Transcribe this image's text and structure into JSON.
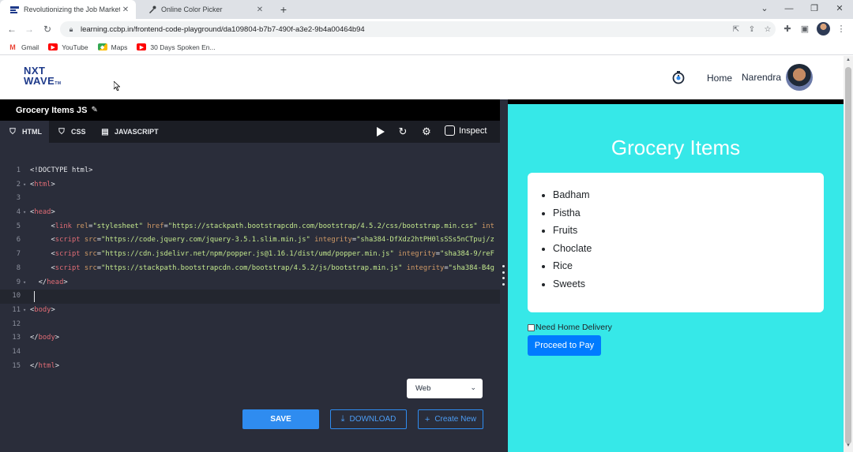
{
  "browser": {
    "tabs": [
      {
        "title": "Revolutionizing the Job Market |",
        "active": true
      },
      {
        "title": "Online Color Picker",
        "active": false
      }
    ],
    "url": "learning.ccbp.in/frontend-code-playground/da109804-b7b7-490f-a3e2-9b4a00464b94",
    "bookmarks": [
      {
        "label": "Gmail",
        "icon": "gmail-icon",
        "color": "#ea4335"
      },
      {
        "label": "YouTube",
        "icon": "youtube-icon",
        "color": "#ff0000"
      },
      {
        "label": "Maps",
        "icon": "maps-icon",
        "color": "#34a853"
      },
      {
        "label": "30 Days Spoken En...",
        "icon": "youtube-icon",
        "color": "#ff0000"
      }
    ]
  },
  "site": {
    "logo_line1": "NXT",
    "logo_line2": "WAVE",
    "logo_tm": "TM",
    "nav_home": "Home",
    "user_name": "Narendra"
  },
  "editor": {
    "file_name": "Grocery Items JS",
    "tabs": [
      {
        "label": "HTML",
        "icon": "html5-icon",
        "active": true
      },
      {
        "label": "CSS",
        "icon": "css3-icon",
        "active": false
      },
      {
        "label": "JAVASCRIPT",
        "icon": "js-file-icon",
        "active": false
      }
    ],
    "inspect_label": "Inspect",
    "lines": [
      {
        "n": "1"
      },
      {
        "n": "2"
      },
      {
        "n": "3"
      },
      {
        "n": "4"
      },
      {
        "n": "5"
      },
      {
        "n": "6"
      },
      {
        "n": "7"
      },
      {
        "n": "8"
      },
      {
        "n": "9"
      },
      {
        "n": "10"
      },
      {
        "n": "11"
      },
      {
        "n": "12"
      },
      {
        "n": "13"
      },
      {
        "n": "14"
      },
      {
        "n": "15"
      }
    ],
    "code": {
      "doctype": "<!DOCTYPE html>",
      "html_open": "html",
      "head_open": "head",
      "link_tag": "link",
      "rel_attr": "rel",
      "rel_val": "\"stylesheet\"",
      "href_attr": "href",
      "href_val": "\"https://stackpath.bootstrapcdn.com/bootstrap/4.5.2/css/bootstrap.min.css\"",
      "int_attr": "int",
      "script_tag": "script",
      "src_attr": "src",
      "src_jquery": "\"https://code.jquery.com/jquery-3.5.1.slim.min.js\"",
      "integrity_attr": "integrity",
      "integrity_jquery": "\"sha384-DfXdz2htPH0lsSSs5nCTpuj/z",
      "src_popper": "\"https://cdn.jsdelivr.net/npm/popper.js@1.16.1/dist/umd/popper.min.js\"",
      "integrity_popper": "\"sha384-9/reF",
      "src_bootstrap": "\"https://stackpath.bootstrapcdn.com/bootstrap/4.5.2/js/bootstrap.min.js\"",
      "integrity_bootstrap": "\"sha384-B4g",
      "head_close": "head",
      "body_open": "body",
      "body_close": "body",
      "html_close": "html"
    },
    "mode_select": "Web",
    "save_label": "SAVE",
    "download_label": "DOWNLOAD",
    "create_label": "Create New"
  },
  "preview": {
    "title": "Grocery Items",
    "items": [
      "Badham",
      "Pistha",
      "Fruits",
      "Choclate",
      "Rice",
      "Sweets"
    ],
    "delivery_label": "Need Home Delivery",
    "pay_label": "Proceed to Pay",
    "bg_color": "#36e8e8"
  }
}
